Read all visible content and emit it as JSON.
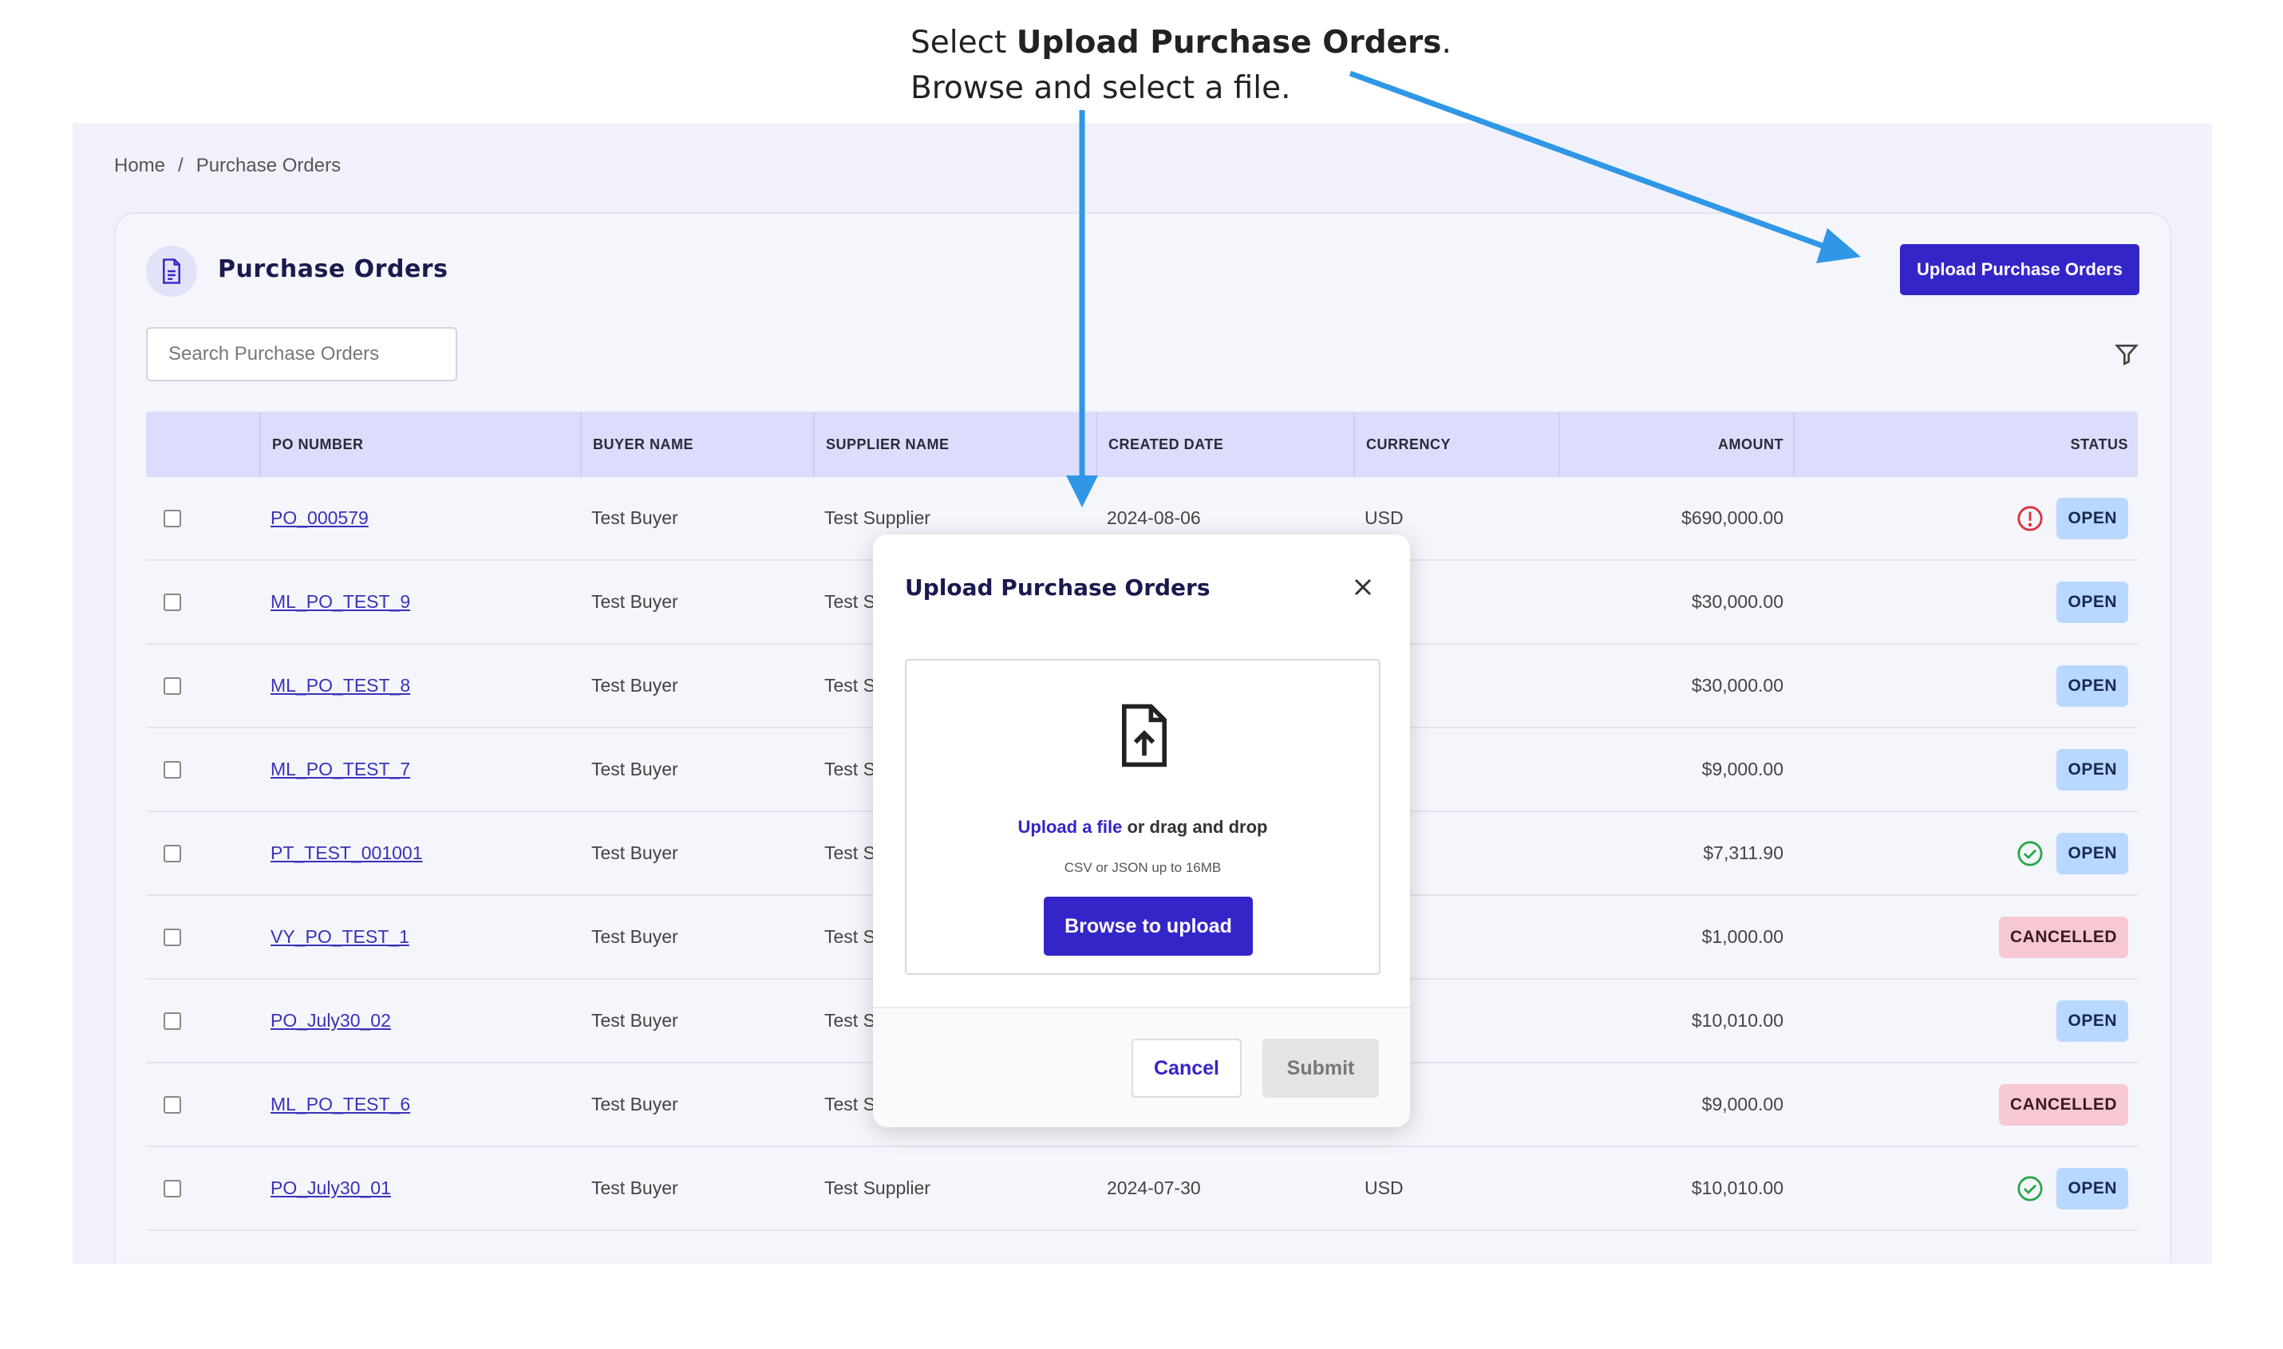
{
  "caption": {
    "line1_pre": "Select ",
    "line1_bold": "Upload Purchase Orders",
    "line1_post": ".",
    "line2": "Browse and select a file."
  },
  "breadcrumb": {
    "home": "Home",
    "sep": "/",
    "current": "Purchase Orders"
  },
  "page": {
    "title": "Purchase Orders",
    "icon": "document-icon",
    "upload_button": "Upload Purchase Orders",
    "search_placeholder": "Search Purchase Orders",
    "filter_icon": "filter-icon"
  },
  "table": {
    "columns": [
      "PO NUMBER",
      "BUYER NAME",
      "SUPPLIER NAME",
      "CREATED DATE",
      "CURRENCY",
      "AMOUNT",
      "STATUS"
    ],
    "rows": [
      {
        "po": "PO_000579",
        "buyer": "Test Buyer",
        "supplier": "Test Supplier",
        "date": "2024-08-06",
        "currency": "USD",
        "amount": "$690,000.00",
        "status": "OPEN",
        "status_icon": "alert-icon"
      },
      {
        "po": "ML_PO_TEST_9",
        "buyer": "Test Buyer",
        "supplier": "Test Su",
        "date": "",
        "currency": "",
        "amount": "$30,000.00",
        "status": "OPEN",
        "status_icon": ""
      },
      {
        "po": "ML_PO_TEST_8",
        "buyer": "Test Buyer",
        "supplier": "Test Su",
        "date": "",
        "currency": "",
        "amount": "$30,000.00",
        "status": "OPEN",
        "status_icon": ""
      },
      {
        "po": "ML_PO_TEST_7",
        "buyer": "Test Buyer",
        "supplier": "Test Su",
        "date": "",
        "currency": "",
        "amount": "$9,000.00",
        "status": "OPEN",
        "status_icon": ""
      },
      {
        "po": "PT_TEST_001001",
        "buyer": "Test Buyer",
        "supplier": "Test Su",
        "date": "",
        "currency": "",
        "amount": "$7,311.90",
        "status": "OPEN",
        "status_icon": "check-circle-icon"
      },
      {
        "po": "VY_PO_TEST_1",
        "buyer": "Test Buyer",
        "supplier": "Test Su",
        "date": "",
        "currency": "",
        "amount": "$1,000.00",
        "status": "CANCELLED",
        "status_icon": ""
      },
      {
        "po": "PO_July30_02",
        "buyer": "Test Buyer",
        "supplier": "Test Su",
        "date": "",
        "currency": "",
        "amount": "$10,010.00",
        "status": "OPEN",
        "status_icon": ""
      },
      {
        "po": "ML_PO_TEST_6",
        "buyer": "Test Buyer",
        "supplier": "Test Su",
        "date": "",
        "currency": "",
        "amount": "$9,000.00",
        "status": "CANCELLED",
        "status_icon": ""
      },
      {
        "po": "PO_July30_01",
        "buyer": "Test Buyer",
        "supplier": "Test Supplier",
        "date": "2024-07-30",
        "currency": "USD",
        "amount": "$10,010.00",
        "status": "OPEN",
        "status_icon": "check-circle-icon"
      }
    ]
  },
  "modal": {
    "title": "Upload Purchase Orders",
    "close_icon": "close-icon",
    "file_icon": "file-upload-icon",
    "upload_link": "Upload a file",
    "drag_text": " or drag and drop",
    "hint": "CSV or JSON up to 16MB",
    "browse_button": "Browse to upload",
    "cancel_button": "Cancel",
    "submit_button": "Submit"
  },
  "colors": {
    "accent": "#3525c9",
    "header_bg": "#dcdcfc",
    "open_badge": "#b9d8ff",
    "cancelled_badge": "#f8c8d2",
    "arrow": "#2f97e6",
    "alert": "#e0303a",
    "success": "#2aa84a"
  }
}
